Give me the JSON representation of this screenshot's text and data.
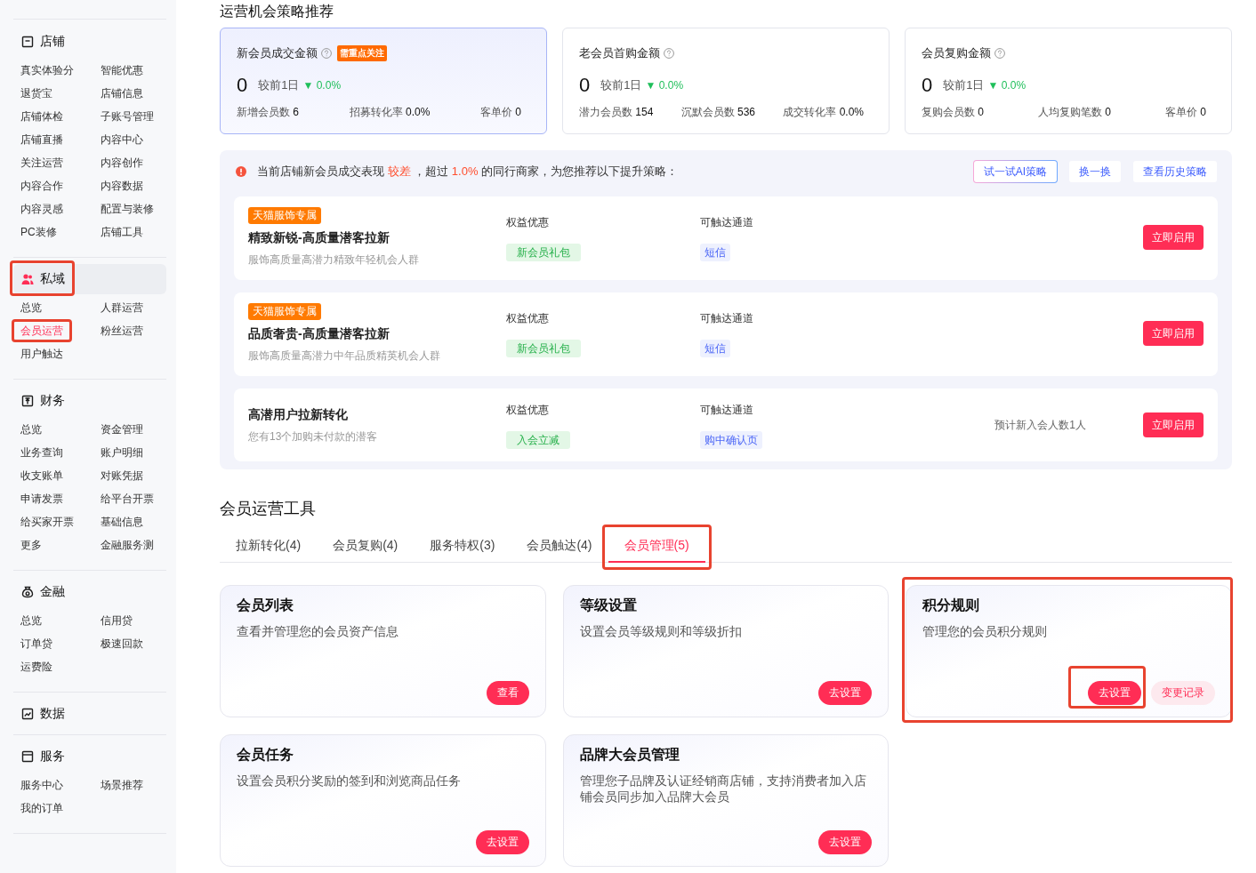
{
  "heading": "运营机会策略推荐",
  "sidebar": {
    "sections": [
      {
        "title": "店铺",
        "selected": false,
        "highlighted": false,
        "items": [
          {
            "label": "真实体验分",
            "selected": false,
            "highlighted": false
          },
          {
            "label": "智能优惠",
            "selected": false,
            "highlighted": false
          },
          {
            "label": "退货宝",
            "selected": false,
            "highlighted": false
          },
          {
            "label": "店铺信息",
            "selected": false,
            "highlighted": false
          },
          {
            "label": "店铺体检",
            "selected": false,
            "highlighted": false
          },
          {
            "label": "子账号管理",
            "selected": false,
            "highlighted": false
          },
          {
            "label": "店铺直播",
            "selected": false,
            "highlighted": false
          },
          {
            "label": "内容中心",
            "selected": false,
            "highlighted": false
          },
          {
            "label": "关注运营",
            "selected": false,
            "highlighted": false
          },
          {
            "label": "内容创作",
            "selected": false,
            "highlighted": false
          },
          {
            "label": "内容合作",
            "selected": false,
            "highlighted": false
          },
          {
            "label": "内容数据",
            "selected": false,
            "highlighted": false
          },
          {
            "label": "内容灵感",
            "selected": false,
            "highlighted": false
          },
          {
            "label": "配置与装修",
            "selected": false,
            "highlighted": false
          },
          {
            "label": "PC装修",
            "selected": false,
            "highlighted": false
          },
          {
            "label": "店铺工具",
            "selected": false,
            "highlighted": false
          }
        ]
      },
      {
        "title": "私域",
        "selected": true,
        "highlighted": true,
        "items": [
          {
            "label": "总览",
            "selected": false,
            "highlighted": false
          },
          {
            "label": "人群运营",
            "selected": false,
            "highlighted": false
          },
          {
            "label": "会员运营",
            "selected": true,
            "highlighted": true
          },
          {
            "label": "粉丝运营",
            "selected": false,
            "highlighted": false
          },
          {
            "label": "用户触达",
            "selected": false,
            "highlighted": false
          }
        ]
      },
      {
        "title": "财务",
        "selected": false,
        "highlighted": false,
        "items": [
          {
            "label": "总览",
            "selected": false,
            "highlighted": false
          },
          {
            "label": "资金管理",
            "selected": false,
            "highlighted": false
          },
          {
            "label": "业务查询",
            "selected": false,
            "highlighted": false
          },
          {
            "label": "账户明细",
            "selected": false,
            "highlighted": false
          },
          {
            "label": "收支账单",
            "selected": false,
            "highlighted": false
          },
          {
            "label": "对账凭据",
            "selected": false,
            "highlighted": false
          },
          {
            "label": "申请发票",
            "selected": false,
            "highlighted": false
          },
          {
            "label": "给平台开票",
            "selected": false,
            "highlighted": false
          },
          {
            "label": "给买家开票",
            "selected": false,
            "highlighted": false
          },
          {
            "label": "基础信息",
            "selected": false,
            "highlighted": false
          },
          {
            "label": "更多",
            "selected": false,
            "highlighted": false
          },
          {
            "label": "金融服务测",
            "selected": false,
            "highlighted": false
          }
        ]
      },
      {
        "title": "金融",
        "selected": false,
        "highlighted": false,
        "items": [
          {
            "label": "总览",
            "selected": false,
            "highlighted": false
          },
          {
            "label": "信用贷",
            "selected": false,
            "highlighted": false
          },
          {
            "label": "订单贷",
            "selected": false,
            "highlighted": false
          },
          {
            "label": "极速回款",
            "selected": false,
            "highlighted": false
          },
          {
            "label": "运费险",
            "selected": false,
            "highlighted": false
          }
        ]
      },
      {
        "title": "数据",
        "selected": false,
        "highlighted": false
      },
      {
        "title": "服务",
        "selected": false,
        "highlighted": false,
        "items": [
          {
            "label": "服务中心",
            "selected": false,
            "highlighted": false
          },
          {
            "label": "场景推荐",
            "selected": false,
            "highlighted": false
          },
          {
            "label": "我的订单",
            "selected": false,
            "highlighted": false
          }
        ]
      }
    ]
  },
  "metrics": [
    {
      "title": "新会员成交金额",
      "badge": "需重点关注",
      "selected": true,
      "value": "0",
      "compare_label": "较前1日",
      "change": "▼ 0.0%",
      "stats": [
        {
          "label": "新增会员数",
          "value": "6"
        },
        {
          "label": "招募转化率",
          "value": "0.0%"
        },
        {
          "label": "客单价",
          "value": "0"
        }
      ]
    },
    {
      "title": "老会员首购金额",
      "selected": false,
      "value": "0",
      "compare_label": "较前1日",
      "change": "▼ 0.0%",
      "stats": [
        {
          "label": "潜力会员数",
          "value": "154"
        },
        {
          "label": "沉默会员数",
          "value": "536"
        },
        {
          "label": "成交转化率",
          "value": "0.0%"
        }
      ]
    },
    {
      "title": "会员复购金额",
      "selected": false,
      "value": "0",
      "compare_label": "较前1日",
      "change": "▼ 0.0%",
      "stats": [
        {
          "label": "复购会员数",
          "value": "0"
        },
        {
          "label": "人均复购笔数",
          "value": "0"
        },
        {
          "label": "客单价",
          "value": "0"
        }
      ]
    }
  ],
  "strategy": {
    "message": [
      {
        "text": "当前店铺新会员成交表现 ",
        "emphasis": false
      },
      {
        "text": "较差",
        "emphasis": true
      },
      {
        "text": " ，超过 ",
        "emphasis": false
      },
      {
        "text": "1.0%",
        "emphasis": true
      },
      {
        "text": " 的同行商家，为您推荐以下提升策略：",
        "emphasis": false
      }
    ],
    "actions": [
      {
        "label": "试一试AI策略",
        "kind": "ai"
      },
      {
        "label": "换一换",
        "kind": "plain"
      },
      {
        "label": "查看历史策略",
        "kind": "plain"
      }
    ],
    "items": [
      {
        "tag": "天猫服饰专属",
        "title": "精致新锐-高质量潜客拉新",
        "description": "服饰高质量高潜力精致年轻机会人群",
        "benefit_label": "权益优惠",
        "benefit": "新会员礼包",
        "channel_label": "可触达通道",
        "channel": "短信",
        "action": "立即启用"
      },
      {
        "tag": "天猫服饰专属",
        "title": "品质奢贵-高质量潜客拉新",
        "description": "服饰高质量高潜力中年品质精英机会人群",
        "benefit_label": "权益优惠",
        "benefit": "新会员礼包",
        "channel_label": "可触达通道",
        "channel": "短信",
        "action": "立即启用"
      },
      {
        "title": "高潜用户拉新转化",
        "description": "您有13个加购未付款的潜客",
        "benefit_label": "权益优惠",
        "benefit": "入会立减",
        "channel_label": "可触达通道",
        "channel": "购中确认页",
        "estimate": "预计新入会人数1人",
        "action": "立即启用"
      }
    ]
  },
  "tools": {
    "title": "会员运营工具",
    "tabs": [
      {
        "label": "拉新转化(4)",
        "selected": false,
        "highlighted": false
      },
      {
        "label": "会员复购(4)",
        "selected": false,
        "highlighted": false
      },
      {
        "label": "服务特权(3)",
        "selected": false,
        "highlighted": false
      },
      {
        "label": "会员触达(4)",
        "selected": false,
        "highlighted": false
      },
      {
        "label": "会员管理(5)",
        "selected": true,
        "highlighted": true
      }
    ],
    "cards": [
      {
        "title": "会员列表",
        "description": "查看并管理您的会员资产信息",
        "highlighted": false,
        "buttons": [
          {
            "label": "查看",
            "kind": "primary",
            "highlighted": false
          }
        ]
      },
      {
        "title": "等级设置",
        "description": "设置会员等级规则和等级折扣",
        "highlighted": false,
        "buttons": [
          {
            "label": "去设置",
            "kind": "primary",
            "highlighted": false
          }
        ]
      },
      {
        "title": "积分规则",
        "description": "管理您的会员积分规则",
        "highlighted": true,
        "buttons": [
          {
            "label": "去设置",
            "kind": "primary",
            "highlighted": true
          },
          {
            "label": "变更记录",
            "kind": "secondary",
            "highlighted": false
          }
        ]
      },
      {
        "title": "会员任务",
        "description": "设置会员积分奖励的签到和浏览商品任务",
        "highlighted": false,
        "buttons": [
          {
            "label": "去设置",
            "kind": "primary",
            "highlighted": false
          }
        ]
      },
      {
        "title": "品牌大会员管理",
        "description": "管理您子品牌及认证经销商店铺，支持消费者加入店铺会员同步加入品牌大会员",
        "highlighted": false,
        "buttons": [
          {
            "label": "去设置",
            "kind": "primary",
            "highlighted": false
          }
        ]
      }
    ]
  }
}
